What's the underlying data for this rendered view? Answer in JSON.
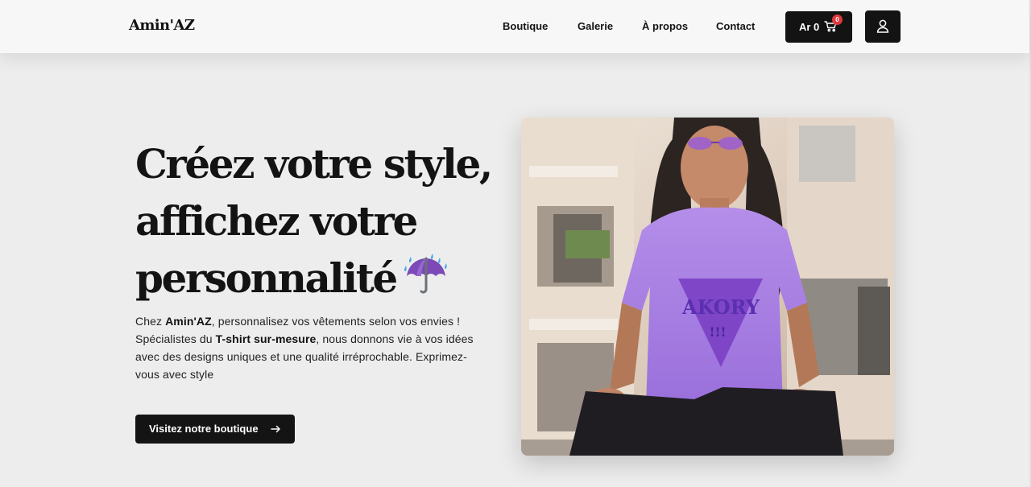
{
  "header": {
    "logo": "Amin'AZ",
    "nav": [
      "Boutique",
      "Galerie",
      "À propos",
      "Contact"
    ],
    "cart": {
      "label": "Ar 0",
      "count": "0"
    }
  },
  "hero": {
    "headline_lines": [
      "Créez votre style,",
      "affichez votre",
      "personnalité"
    ],
    "paragraph": {
      "p1": "Chez ",
      "brand": "Amin'AZ",
      "p2": ", personnalisez vos vêtements selon vos envies ! Spécialistes du ",
      "highlight": "T-shirt sur-mesure",
      "p3": ", nous donnons vie à vos idées avec des designs uniques et une qualité irréprochable. Exprimez-vous avec style"
    },
    "cta": "Visitez notre boutique",
    "image": {
      "shirt_print": "AKORY",
      "shirt_print_sub": "!!!"
    }
  },
  "colors": {
    "dark": "#131313",
    "background": "#ededed",
    "header": "#f7f7f7",
    "badge": "#e0383c",
    "shirt": "#a77ee6"
  },
  "icons": [
    "cart-icon",
    "user-icon",
    "arrow-right-icon",
    "umbrella-rain-emoji"
  ]
}
